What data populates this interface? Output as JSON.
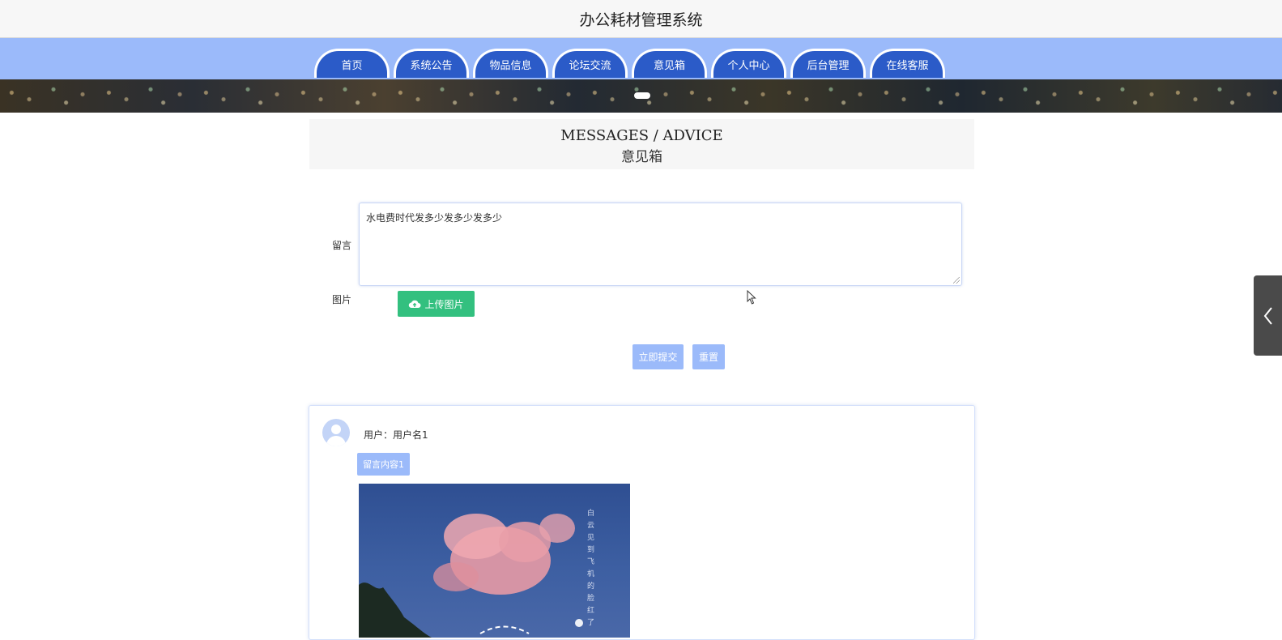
{
  "site": {
    "title": "办公耗材管理系统"
  },
  "nav": {
    "items": [
      "首页",
      "系统公告",
      "物品信息",
      "论坛交流",
      "意见箱",
      "个人中心",
      "后台管理",
      "在线客服"
    ]
  },
  "banner": {
    "icon": "city-night-banner"
  },
  "heading": {
    "en": "MESSAGES / ADVICE",
    "zh": "意见箱"
  },
  "form": {
    "message_label": "留言",
    "message_value": "水电费时代发多少发多少发多少",
    "image_label": "图片",
    "upload_label": "上传图片",
    "submit_label": "立即提交",
    "reset_label": "重置"
  },
  "comments": [
    {
      "user_label": "用户：",
      "user_name": "用户名1",
      "content": "留言内容1",
      "image_caption": "白云见到飞机的脸红了"
    }
  ],
  "colors": {
    "nav_bg": "#9bbafa",
    "tab_bg": "#2b5bc8",
    "upload_green": "#33c07f",
    "light_button": "#9bbafa"
  },
  "icons": {
    "upload": "cloud-upload-icon",
    "side": "chevron-left-icon",
    "avatar": "user-avatar-icon"
  }
}
